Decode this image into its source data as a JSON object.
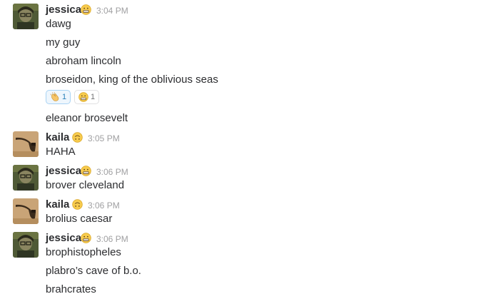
{
  "messages": [
    {
      "user": "jessica",
      "time": "3:04 PM",
      "status_icon": "grimacing-emoji-icon",
      "lines": [
        "dawg",
        "my guy",
        "abroham lincoln",
        "broseidon, king of the oblivious seas"
      ],
      "reactions": [
        {
          "emoji": "clapping-hands-icon",
          "count": "1"
        },
        {
          "emoji": "grimacing-emoji-icon",
          "count": "1"
        }
      ],
      "after_reactions": [
        "eleanor brosevelt"
      ]
    },
    {
      "user": "kaila",
      "time": "3:05 PM",
      "status_icon": "upside-down-face-icon",
      "lines": [
        "HAHA"
      ]
    },
    {
      "user": "jessica",
      "time": "3:06 PM",
      "status_icon": "grimacing-emoji-icon",
      "lines": [
        "brover cleveland"
      ]
    },
    {
      "user": "kaila",
      "time": "3:06 PM",
      "status_icon": "upside-down-face-icon",
      "lines": [
        "brolius caesar"
      ]
    },
    {
      "user": "jessica",
      "time": "3:06 PM",
      "status_icon": "grimacing-emoji-icon",
      "lines": [
        "brophistopheles",
        "plabro’s cave of b.o.",
        "brahcrates"
      ]
    }
  ],
  "colors": {
    "text": "#2c2d30",
    "timestamp": "#a0a0a2",
    "reaction_active_bg": "#eef6fd",
    "reaction_active_border": "#a9d3f4"
  }
}
